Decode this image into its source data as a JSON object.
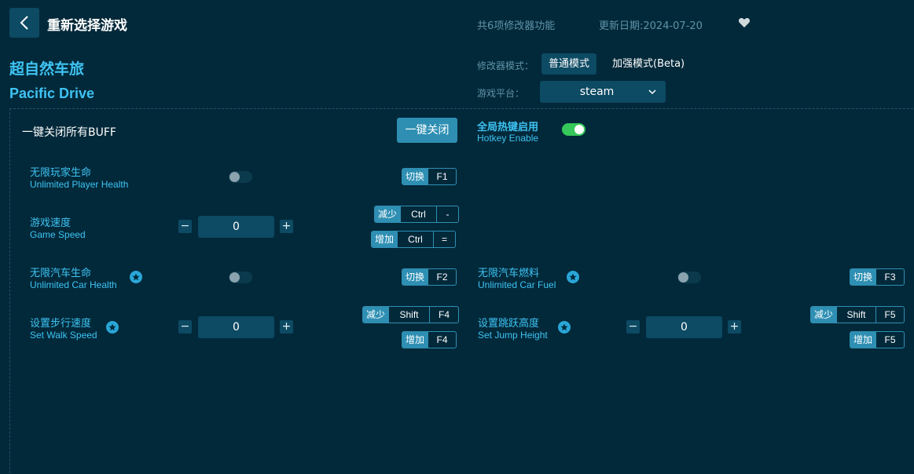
{
  "header": {
    "back_title": "重新选择游戏",
    "feature_count": "共6项修改器功能",
    "update_date": "更新日期:2024-07-20"
  },
  "game": {
    "name_cn": "超自然车旅",
    "name_en": "Pacific Drive"
  },
  "mode": {
    "label": "修改器模式：",
    "normal": "普通模式",
    "enhanced": "加强模式(Beta)",
    "selected": "普通模式"
  },
  "platform": {
    "label": "游戏平台：",
    "value": "steam"
  },
  "controls": {
    "close_all_label": "一键关闭所有BUFF",
    "close_all_button": "一键关闭",
    "hotkey_title": "全局热键启用",
    "hotkey_sub": "Hotkey Enable",
    "hotkey_enabled": true
  },
  "options": {
    "player_health": {
      "cn": "无限玩家生命",
      "en": "Unlimited Player Health",
      "on": false,
      "premium": false,
      "hotkeys": [
        {
          "action": "切换",
          "keys": [
            "F1"
          ]
        }
      ]
    },
    "game_speed": {
      "cn": "游戏速度",
      "en": "Game Speed",
      "value": "0",
      "premium": false,
      "hotkeys": [
        {
          "action": "减少",
          "keys": [
            "Ctrl",
            "-"
          ]
        },
        {
          "action": "增加",
          "keys": [
            "Ctrl",
            "="
          ]
        }
      ]
    },
    "car_health": {
      "cn": "无限汽车生命",
      "en": "Unlimited Car Health",
      "on": false,
      "premium": true,
      "hotkeys": [
        {
          "action": "切换",
          "keys": [
            "F2"
          ]
        }
      ]
    },
    "car_fuel": {
      "cn": "无限汽车燃料",
      "en": "Unlimited Car Fuel",
      "on": false,
      "premium": true,
      "hotkeys": [
        {
          "action": "切换",
          "keys": [
            "F3"
          ]
        }
      ]
    },
    "walk_speed": {
      "cn": "设置步行速度",
      "en": "Set Walk Speed",
      "value": "0",
      "premium": true,
      "hotkeys": [
        {
          "action": "减少",
          "keys": [
            "Shift",
            "F4"
          ]
        },
        {
          "action": "增加",
          "keys": [
            "F4"
          ]
        }
      ]
    },
    "jump_height": {
      "cn": "设置跳跃高度",
      "en": "Set Jump Height",
      "value": "0",
      "premium": true,
      "hotkeys": [
        {
          "action": "减少",
          "keys": [
            "Shift",
            "F5"
          ]
        },
        {
          "action": "增加",
          "keys": [
            "F5"
          ]
        }
      ]
    }
  },
  "stepper": {
    "minus": "−",
    "plus": "+"
  },
  "colors": {
    "background": "#02293a",
    "accent": "#3ec3f3",
    "button": "#2e8fb3",
    "toggle_on": "#36c85a"
  }
}
